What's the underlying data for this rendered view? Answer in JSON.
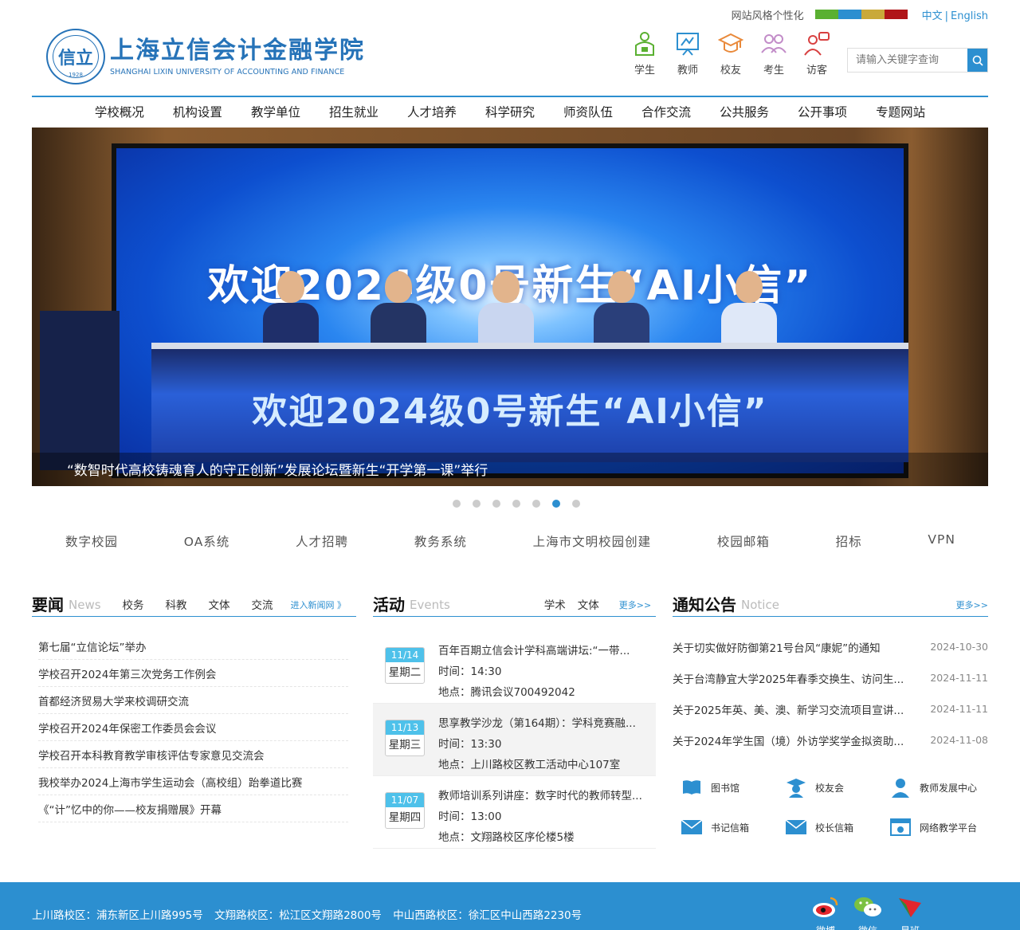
{
  "topbar": {
    "style_label": "网站风格个性化",
    "swatches": [
      "#5ab031",
      "#2c8fd0",
      "#c9a93a",
      "#b01518"
    ],
    "lang_cn": "中文",
    "lang_sep": "|",
    "lang_en": "English"
  },
  "logo": {
    "seal_text": "信立",
    "seal_year": "1928",
    "name_cn": "上海立信会计金融学院",
    "name_en": "SHANGHAI LIXIN UNIVERSITY OF ACCOUNTING AND FINANCE"
  },
  "user_entries": [
    {
      "label": "学生",
      "icon": "student-icon"
    },
    {
      "label": "教师",
      "icon": "teacher-icon"
    },
    {
      "label": "校友",
      "icon": "alumni-icon"
    },
    {
      "label": "考生",
      "icon": "applicant-icon"
    },
    {
      "label": "访客",
      "icon": "visitor-icon"
    }
  ],
  "search": {
    "placeholder": "请输入关键字查询"
  },
  "nav": [
    "学校概况",
    "机构设置",
    "教学单位",
    "招生就业",
    "人才培养",
    "科学研究",
    "师资队伍",
    "合作交流",
    "公共服务",
    "公开事项",
    "专题网站"
  ],
  "banner": {
    "screen_title": "欢迎2024级0号新生“AI小信”",
    "stage_title": "欢迎2024级0号新生“AI小信”",
    "caption": "“数智时代高校铸魂育人的守正创新”发展论坛暨新生“开学第一课”举行",
    "slide_count": 7,
    "active_slide": 6
  },
  "quicklinks": [
    "数字校园",
    "OA系统",
    "人才招聘",
    "教务系统",
    "上海市文明校园创建",
    "校园邮箱",
    "招标",
    "VPN"
  ],
  "news": {
    "title": "要闻",
    "subtitle": "News",
    "tabs": [
      "校务",
      "科教",
      "文体",
      "交流"
    ],
    "more": "进入新闻网 》",
    "items": [
      "第七届“立信论坛”举办",
      "学校召开2024年第三次党务工作例会",
      "首都经济贸易大学来校调研交流",
      "学校召开2024年保密工作委员会会议",
      "学校召开本科教育教学审核评估专家意见交流会",
      "我校举办2024上海市学生运动会（高校组）跆拳道比赛",
      "《“计”忆中的你——校友捐赠展》开幕"
    ]
  },
  "events": {
    "title": "活动",
    "subtitle": "Events",
    "tabs": [
      "学术",
      "文体"
    ],
    "more": "更多>>",
    "items": [
      {
        "date": "11/14",
        "weekday": "星期二",
        "title": "百年百期立信会计学科高端讲坛:“一带...",
        "time": "时间：14:30",
        "place": "地点：腾讯会议700492042"
      },
      {
        "date": "11/13",
        "weekday": "星期三",
        "title": "思享教学沙龙（第164期）：学科竞赛融...",
        "time": "时间：13:30",
        "place": "地点：上川路校区教工活动中心107室"
      },
      {
        "date": "11/07",
        "weekday": "星期四",
        "title": "教师培训系列讲座：数字时代的教师转型...",
        "time": "时间：13:00",
        "place": "地点：文翔路校区序伦楼5楼"
      }
    ]
  },
  "notices": {
    "title": "通知公告",
    "subtitle": "Notice",
    "more": "更多>>",
    "items": [
      {
        "title": "关于切实做好防御第21号台风“康妮”的通知",
        "date": "2024-10-30"
      },
      {
        "title": "关于台湾静宜大学2025年春季交换生、访问生...",
        "date": "2024-11-11"
      },
      {
        "title": "关于2025年英、美、澳、新学习交流项目宣讲...",
        "date": "2024-11-11"
      },
      {
        "title": "关于2024年学生国（境）外访学奖学金拟资助...",
        "date": "2024-11-08"
      }
    ]
  },
  "services": [
    {
      "label": "图书馆",
      "icon": "book-icon"
    },
    {
      "label": "校友会",
      "icon": "graduate-icon"
    },
    {
      "label": "教师发展中心",
      "icon": "teacher-person-icon"
    },
    {
      "label": "书记信箱",
      "icon": "mail-icon"
    },
    {
      "label": "校长信箱",
      "icon": "mail-icon"
    },
    {
      "label": "网络教学平台",
      "icon": "online-platform-icon"
    }
  ],
  "footer": {
    "campus1": "上川路校区：浦东新区上川路995号",
    "campus2": "文翔路校区：松江区文翔路2800号",
    "campus3": "中山西路校区：徐汇区中山西路2230号",
    "social": [
      {
        "label": "微博",
        "icon": "weibo-icon"
      },
      {
        "label": "微信",
        "icon": "wechat-icon"
      },
      {
        "label": "易班",
        "icon": "yiban-icon"
      }
    ]
  },
  "colors": {
    "accent": "#2c8fd0",
    "event_date": "#4ec1ea",
    "footer_bg": "#2c8fd0"
  }
}
